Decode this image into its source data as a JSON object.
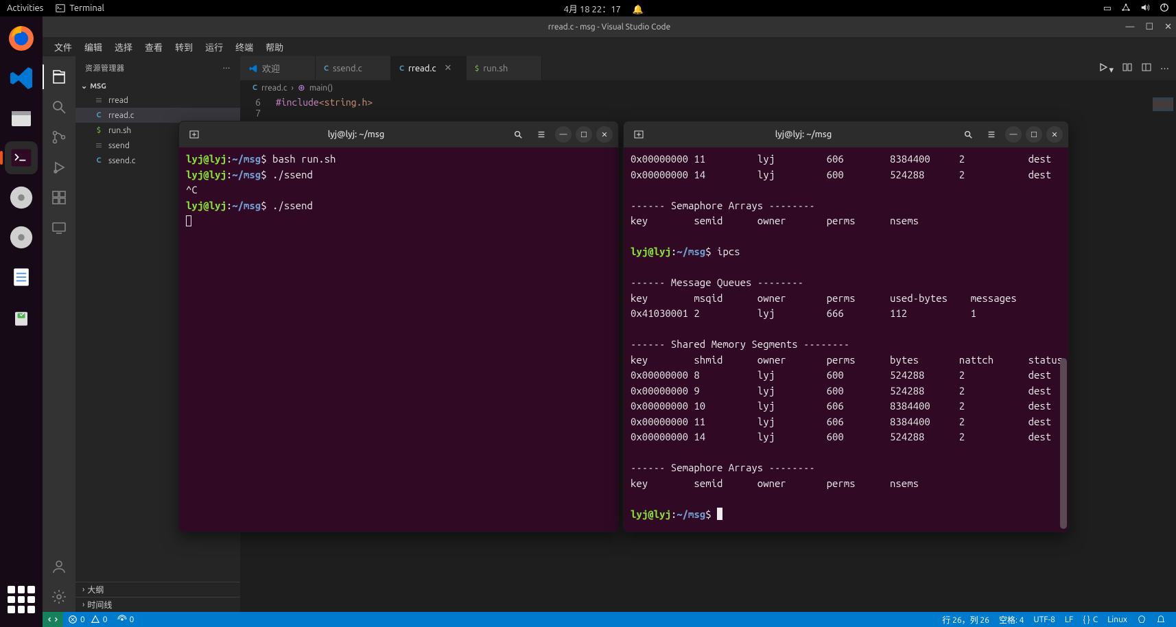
{
  "gnome": {
    "activities": "Activities",
    "app_indicator": "Terminal",
    "clock": "4月 18 22：17"
  },
  "vscode": {
    "title": "rread.c - msg - Visual Studio Code",
    "menus": [
      "文件",
      "编辑",
      "选择",
      "查看",
      "转到",
      "运行",
      "终端",
      "帮助"
    ],
    "explorer_title": "资源管理器",
    "folder_name": "MSG",
    "files": [
      {
        "name": "rread",
        "icon": "bin"
      },
      {
        "name": "rread.c",
        "icon": "c",
        "selected": true
      },
      {
        "name": "run.sh",
        "icon": "sh"
      },
      {
        "name": "ssend",
        "icon": "bin"
      },
      {
        "name": "ssend.c",
        "icon": "c"
      }
    ],
    "outline_label": "大纲",
    "timeline_label": "时间线",
    "tabs": [
      {
        "label": "欢迎",
        "icon": "vs"
      },
      {
        "label": "ssend.c",
        "icon": "c"
      },
      {
        "label": "rread.c",
        "icon": "c",
        "active": true
      },
      {
        "label": "run.sh",
        "icon": "sh"
      }
    ],
    "breadcrumb": {
      "file": "rread.c",
      "symbol": "main()"
    },
    "code_line_no": "6",
    "code_include_kw": "#include ",
    "code_include_str": "<string.h>",
    "statusbar": {
      "errors": "0",
      "warnings": "0",
      "ports": "0",
      "cursor": "行 26，列 26",
      "spaces": "空格: 4",
      "encoding": "UTF-8",
      "eol": "LF",
      "lang_mode": "C",
      "os": "Linux"
    }
  },
  "term_left": {
    "title": "lyj@lyj: ~/msg",
    "lines": [
      {
        "prompt": true,
        "cmd": "bash run.sh"
      },
      {
        "prompt": true,
        "cmd": "./ssend"
      },
      {
        "text": "^C"
      },
      {
        "prompt": true,
        "cmd": "./ssend"
      }
    ]
  },
  "term_right": {
    "title": "lyj@lyj: ~/msg",
    "top_rows": [
      [
        "0x00000000",
        "11",
        "lyj",
        "606",
        "8384400",
        "2",
        "dest"
      ],
      [
        "0x00000000",
        "14",
        "lyj",
        "600",
        "524288",
        "2",
        "dest"
      ]
    ],
    "sem_header": "------ Semaphore Arrays --------",
    "sem_cols": [
      "key",
      "semid",
      "owner",
      "perms",
      "nsems"
    ],
    "cmd": "ipcs",
    "mq_header": "------ Message Queues --------",
    "mq_cols": [
      "key",
      "msqid",
      "owner",
      "perms",
      "used-bytes",
      "messages"
    ],
    "mq_rows": [
      [
        "0x41030001",
        "2",
        "lyj",
        "666",
        "112",
        "1"
      ]
    ],
    "shm_header": "------ Shared Memory Segments --------",
    "shm_cols": [
      "key",
      "shmid",
      "owner",
      "perms",
      "bytes",
      "nattch",
      "status"
    ],
    "shm_rows": [
      [
        "0x00000000",
        "8",
        "lyj",
        "600",
        "524288",
        "2",
        "dest"
      ],
      [
        "0x00000000",
        "9",
        "lyj",
        "600",
        "524288",
        "2",
        "dest"
      ],
      [
        "0x00000000",
        "10",
        "lyj",
        "606",
        "8384400",
        "2",
        "dest"
      ],
      [
        "0x00000000",
        "11",
        "lyj",
        "606",
        "8384400",
        "2",
        "dest"
      ],
      [
        "0x00000000",
        "14",
        "lyj",
        "600",
        "524288",
        "2",
        "dest"
      ]
    ],
    "sem2_header": "------ Semaphore Arrays --------",
    "sem2_cols": [
      "key",
      "semid",
      "owner",
      "perms",
      "nsems"
    ]
  },
  "prompt_user": "lyj@lyj",
  "prompt_sep": ":",
  "prompt_path": "~/msg",
  "prompt_char": "$"
}
